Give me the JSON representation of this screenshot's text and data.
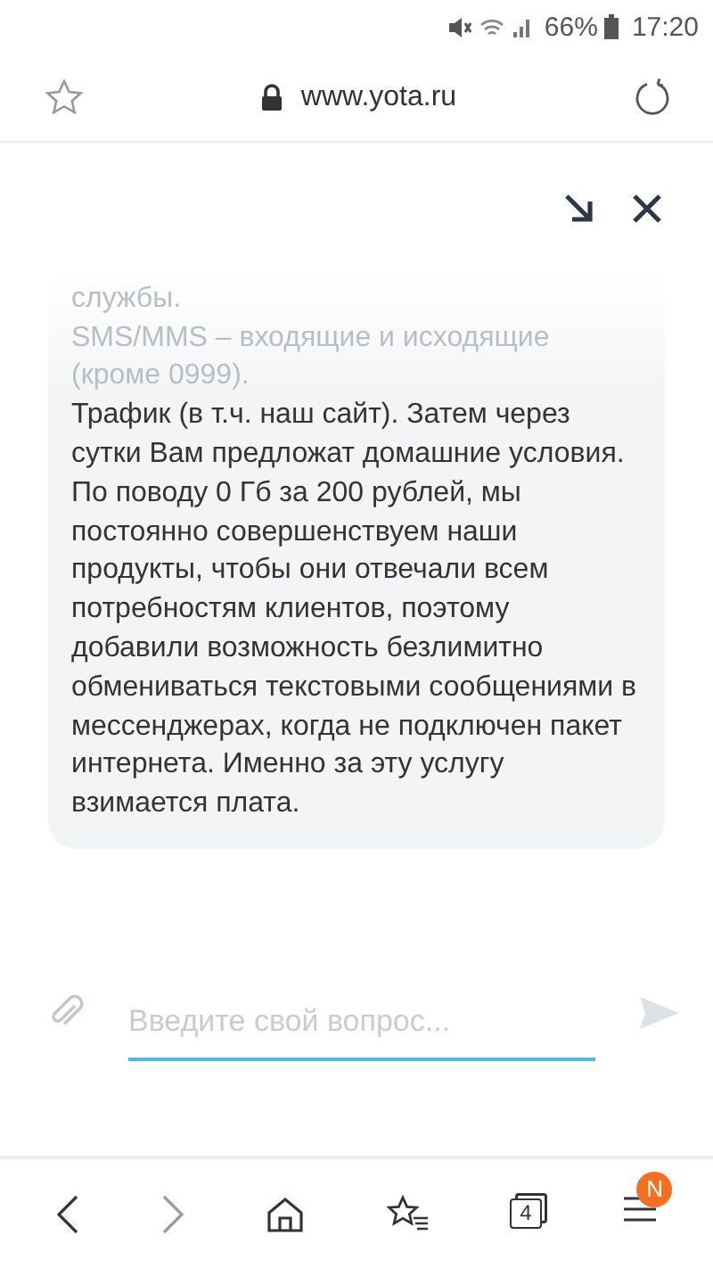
{
  "status_bar": {
    "battery": "66%",
    "time": "17:20"
  },
  "address_bar": {
    "url": "www.yota.ru",
    "secure": true
  },
  "chat": {
    "messages": [
      {
        "text": "службы.",
        "faded": true
      },
      {
        "text": "SMS/MMS – входящие и исходящие (кроме 0999).",
        "faded": true
      },
      {
        "text": "Трафик (в т.ч. наш сайт). Затем через сутки Вам предложат домашние условия.",
        "faded": false
      },
      {
        "text": "По поводу 0 Гб за 200 рублей, мы постоянно совершенствуем наши продукты, чтобы они отвечали всем потребностям клиентов, поэтому добавили возможность безлимитно обмениваться текстовыми сообщениями в мессенджерах, когда не подключен пакет интернета. Именно за эту услугу взимается плата.",
        "faded": false
      }
    ],
    "input": {
      "placeholder": "Введите свой вопрос..."
    }
  },
  "bottom_nav": {
    "tabs_count": "4",
    "menu_badge": "N"
  }
}
